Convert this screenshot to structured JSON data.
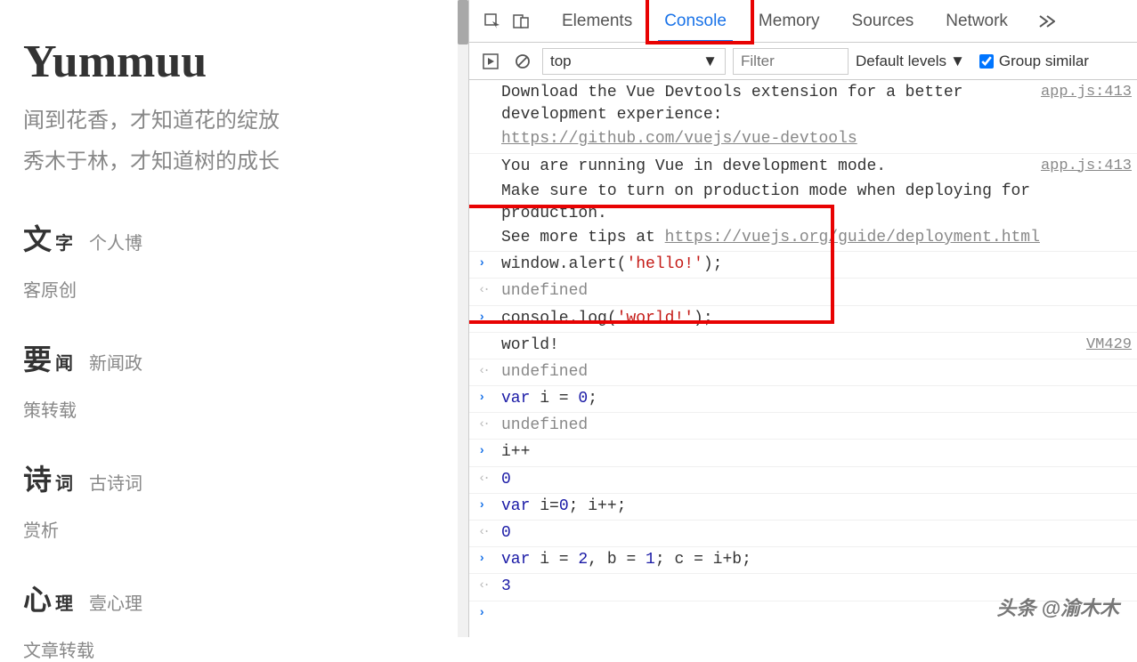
{
  "site": {
    "title": "Yummuu",
    "subtitle1": "闻到花香，才知道花的绽放",
    "subtitle2": "秀木于林，才知道树的成长",
    "nav": [
      {
        "big": "文",
        "suffix": "字",
        "desc": "个人博",
        "line2": "客原创"
      },
      {
        "big": "要",
        "suffix": "闻",
        "desc": "新闻政",
        "line2": "策转载"
      },
      {
        "big": "诗",
        "suffix": "词",
        "desc": "古诗词",
        "line2": "赏析"
      },
      {
        "big": "心",
        "suffix": "理",
        "desc": "壹心理",
        "line2": "文章转载"
      }
    ]
  },
  "devtools": {
    "tabs": [
      "Elements",
      "Console",
      "Memory",
      "Sources",
      "Network"
    ],
    "active_tab": "Console",
    "context": "top",
    "filter_placeholder": "Filter",
    "levels": "Default levels",
    "group_label": "Group similar",
    "logs": [
      {
        "type": "info",
        "text_parts": [
          {
            "t": "Download the Vue Devtools extension for a better development experience:"
          }
        ],
        "link": "app.js:413"
      },
      {
        "type": "info-cont",
        "url": "https://github.com/vuejs/vue-devtools"
      },
      {
        "type": "info",
        "text_parts": [
          {
            "t": "You are running Vue in development mode."
          }
        ],
        "link": "app.js:413"
      },
      {
        "type": "info-cont",
        "text": "Make sure to turn on production mode when deploying for production."
      },
      {
        "type": "info-cont",
        "text_pre": "See more tips at ",
        "url": "https://vuejs.org/guide/deployment.html"
      },
      {
        "type": "input",
        "code": "window.alert('hello!');",
        "str": "'hello!'"
      },
      {
        "type": "output",
        "text": "undefined",
        "cls": "undef"
      },
      {
        "type": "input",
        "code": "console.log('world!');",
        "str": "'world!'"
      },
      {
        "type": "log",
        "text": "world!",
        "link": "VM429"
      },
      {
        "type": "output",
        "text": "undefined",
        "cls": "undef"
      },
      {
        "type": "input",
        "code": "var i = 0;",
        "kw": "var",
        "num": "0"
      },
      {
        "type": "output",
        "text": "undefined",
        "cls": "undef"
      },
      {
        "type": "input",
        "code": "i++"
      },
      {
        "type": "output",
        "text": "0",
        "cls": "num"
      },
      {
        "type": "input",
        "code": "var i=0; i++;",
        "kw": "var",
        "num": "0"
      },
      {
        "type": "output",
        "text": "0",
        "cls": "num"
      },
      {
        "type": "input",
        "code": "var i = 2, b = 1; c = i+b;",
        "kw": "var"
      },
      {
        "type": "output",
        "text": "3",
        "cls": "num"
      },
      {
        "type": "prompt"
      }
    ]
  },
  "watermark": "头条 @渝木木"
}
